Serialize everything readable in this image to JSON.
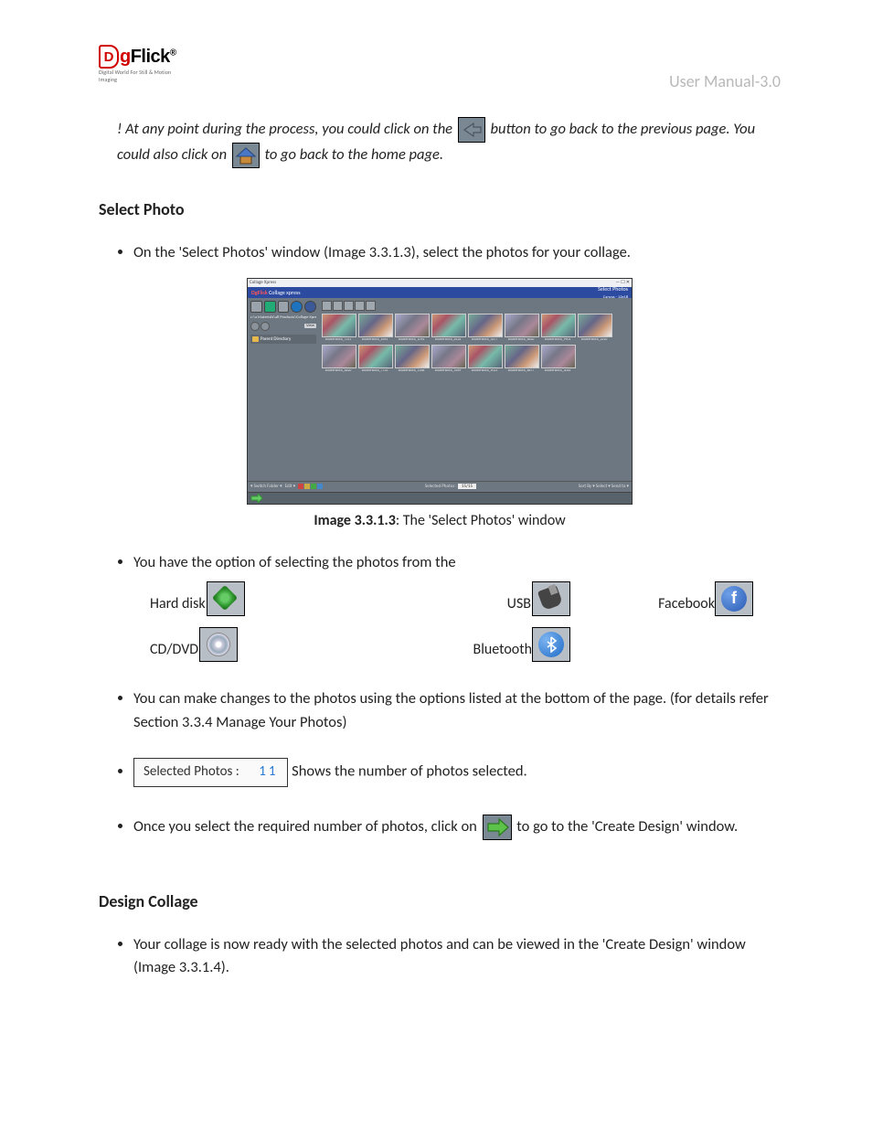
{
  "header": {
    "logo_main": "gFlick",
    "logo_tagline": "Digital World For Still & Motion Imaging",
    "doc_title": "User Manual-3.0"
  },
  "tip": {
    "part1": "! At any point during the process, you could click on the ",
    "part2": " button to go back to the previous page. You could also click on ",
    "part3": " to go back to the home page."
  },
  "sections": {
    "select_photo_h": "Select Photo",
    "bullet1": "On the 'Select Photos' window (Image 3.3.1.3), select the photos for your collage.",
    "caption_img_label": "Image 3.3.1.3",
    "caption_img_text": ": The 'Select Photos' window",
    "bullet2": "You have the option of selecting the photos from the",
    "options": {
      "hard_disk": "Hard disk",
      "usb": "USB",
      "facebook": "Facebook",
      "cd_dvd": "CD/DVD",
      "bluetooth": "Bluetooth"
    },
    "bullet3": "You can make changes to the photos using the options listed at the bottom of the page. (for details refer Section 3.3.4 Manage Your Photos)",
    "selected_label": "Selected Photos :",
    "selected_count": "11",
    "bullet4_after": " Shows the number of photos selected.",
    "bullet5_a": "Once you select the required number of photos, click on ",
    "bullet5_b": " to go to the 'Create Design' window.",
    "design_h": "Design Collage",
    "bullet6": "Your collage is now ready with the selected photos and can be viewed in the 'Create Design' window (Image 3.3.1.4)."
  },
  "screenshot": {
    "titlebar": "Collage Xpress",
    "brand": "DgFlick",
    "subbrand": "Collage xpress",
    "header_right": "Select Photos",
    "header_right2": "Canvas - 12x18",
    "path": "c:\\a Materials\\all Products\\Collage Xpress\\",
    "view_btn": "View",
    "folder": "Parent Directory",
    "thumbs": [
      "shutterstock_7311",
      "shutterstock_4561",
      "shutterstock_1092",
      "shutterstock_8124",
      "shutterstock_3377",
      "shutterstock_6620",
      "shutterstock_9901",
      "shutterstock_2210",
      "shutterstock_4820",
      "shutterstock_7733",
      "shutterstock_1188",
      "shutterstock_5569",
      "shutterstock_9021",
      "shutterstock_6677",
      "shutterstock_3044"
    ],
    "status_switchfolder": "Switch Folder",
    "status_edit": "Edit",
    "status_sel_label": "Selected Photos :",
    "status_sel_val": "15/15",
    "status_sort": "Sort By",
    "status_select": "Select",
    "status_sendto": "Send to",
    "zoom_btn": "Zoom"
  }
}
